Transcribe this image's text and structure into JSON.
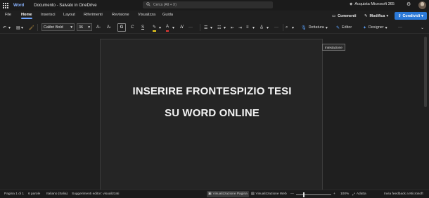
{
  "titlebar": {
    "app_name": "Word",
    "doc_title": "Documento - Salvato in OneDrive",
    "search_placeholder": "Cerca (Alt + X)",
    "buy_label": "Acquista Microsoft 365"
  },
  "menubar": {
    "tabs": [
      "File",
      "Home",
      "Inserisci",
      "Layout",
      "Riferimenti",
      "Revisione",
      "Visualizza",
      "Guida"
    ],
    "active_tab": "Home",
    "comments_label": "Commenti",
    "edit_label": "Modifica",
    "share_label": "Condividi"
  },
  "ribbon": {
    "font_name": "Calibri Bold",
    "font_size": "36",
    "dictate_label": "Dettatura",
    "editor_label": "Editor",
    "designer_label": "Designer",
    "more_label": "···"
  },
  "document": {
    "line1": "INSERIRE FRONTESPIZIO TESI",
    "line2": "SU WORD ONLINE"
  },
  "tooltip": "Intestazione",
  "statusbar": {
    "page": "Pagina 1 di 1",
    "words": "6 parole",
    "language": "Italiano (Italia)",
    "suggestions": "Suggerimenti editor: visualizzati",
    "page_view": "Visualizzazione Pagina",
    "web_view": "Visualizzazione Web",
    "zoom_minus": "—",
    "zoom_plus": "+",
    "zoom": "100%",
    "fit": "Adatta",
    "feedback": "Invia feedback a Microsoft"
  },
  "colors": {
    "accent": "#2b79d8",
    "brand_word": "#8ab4ff",
    "highlight": "#f2d21e",
    "font_color": "#e53935"
  }
}
